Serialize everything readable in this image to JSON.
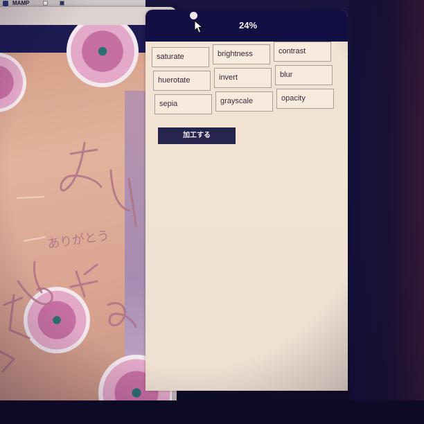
{
  "menubar": {
    "app_name": "MAMP"
  },
  "app": {
    "zoom_level": "24%",
    "filters": [
      {
        "label": "saturate"
      },
      {
        "label": "brightness"
      },
      {
        "label": "contrast"
      },
      {
        "label": "huerotate"
      },
      {
        "label": "invert"
      },
      {
        "label": "blur"
      },
      {
        "label": "sepia"
      },
      {
        "label": "grayscale"
      },
      {
        "label": "opacity"
      }
    ],
    "apply_label": "加工する"
  },
  "image_preview": {
    "scribble_text": "ありがとう"
  },
  "colors": {
    "header_navy": "#120f44",
    "button_navy": "#191744",
    "panel_background": "#f3e3d3",
    "filter_button_border": "#a89a95"
  },
  "icons": {
    "cursor": "arrow-cursor-icon",
    "status": "status-dot-icon"
  }
}
